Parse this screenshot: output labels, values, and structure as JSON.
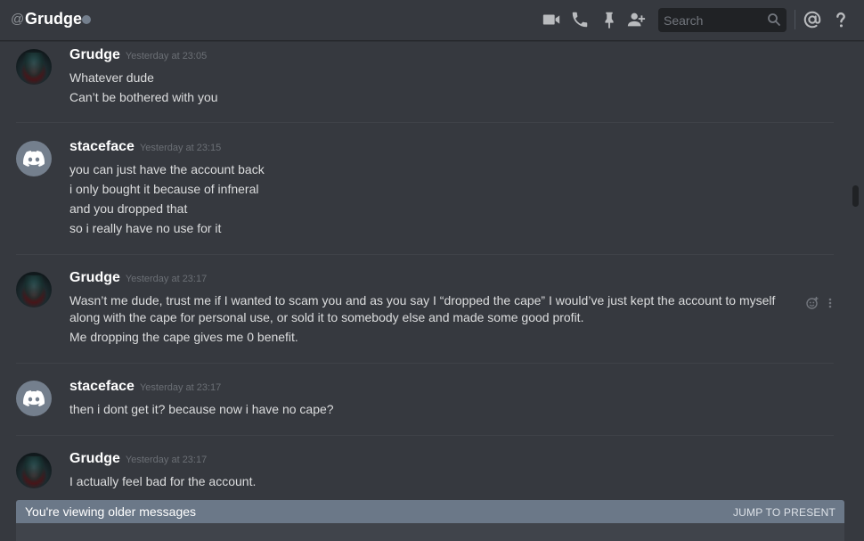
{
  "header": {
    "at_symbol": "@",
    "channel_name": "Grudge",
    "status": "offline",
    "icons": [
      "video-call-icon",
      "voice-call-icon",
      "pin-icon",
      "add-friend-icon",
      "at-icon",
      "help-icon"
    ],
    "search_placeholder": "Search",
    "at_label": "@",
    "help_label": "?"
  },
  "messages": [
    {
      "author": "Grudge",
      "timestamp": "Yesterday at 23:05",
      "avatar": "grudge-avatar",
      "lines": [
        "Whatever dude",
        "Can’t be bothered with you"
      ]
    },
    {
      "author": "staceface",
      "timestamp": "Yesterday at 23:15",
      "avatar": "discord-default-avatar",
      "lines": [
        "you can just have the account back",
        "i only bought it because of infneral",
        "and you dropped that",
        "so i really have no use for it"
      ]
    },
    {
      "author": "Grudge",
      "timestamp": "Yesterday at 23:17",
      "avatar": "grudge-avatar",
      "lines": [
        "Wasn’t me dude, trust me if I wanted to scam you and as you say I “dropped the cape” I would’ve just kept the account to myself",
        "along with the cape for personal use, or sold it to somebody else and made some good profit.",
        "Me dropping the cape gives me 0 benefit."
      ]
    },
    {
      "author": "staceface",
      "timestamp": "Yesterday at 23:17",
      "avatar": "discord-default-avatar",
      "lines": [
        "then i dont get it? because now i have no cape?"
      ]
    },
    {
      "author": "Grudge",
      "timestamp": "Yesterday at 23:17",
      "avatar": "grudge-avatar",
      "lines": [
        "I actually feel bad for the account."
      ]
    }
  ],
  "older_bar": {
    "text": "You're viewing older messages",
    "jump_label": "JUMP TO PRESENT"
  },
  "colors": {
    "background": "#36393f",
    "username": "#ffffff",
    "timestamp": "#6b6f75",
    "older_bar": "#6b7888"
  }
}
